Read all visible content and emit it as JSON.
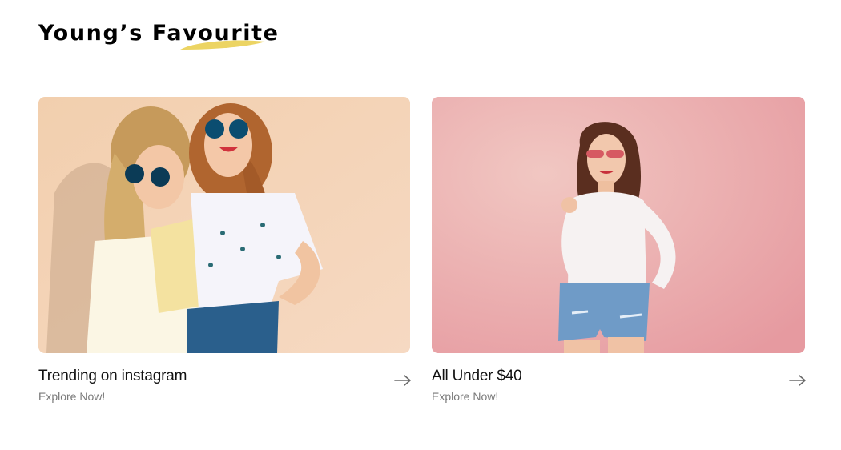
{
  "section": {
    "title": "Young’s Favourite",
    "accent_color": "#ecd463"
  },
  "cards": [
    {
      "title": "Trending on instagram",
      "subtitle": "Explore Now!",
      "arrow_icon": "arrow-right-icon",
      "image": "two-women-sunglasses-photo"
    },
    {
      "title": "All Under $40",
      "subtitle": "Explore Now!",
      "arrow_icon": "arrow-right-icon",
      "image": "woman-pink-background-photo"
    }
  ]
}
